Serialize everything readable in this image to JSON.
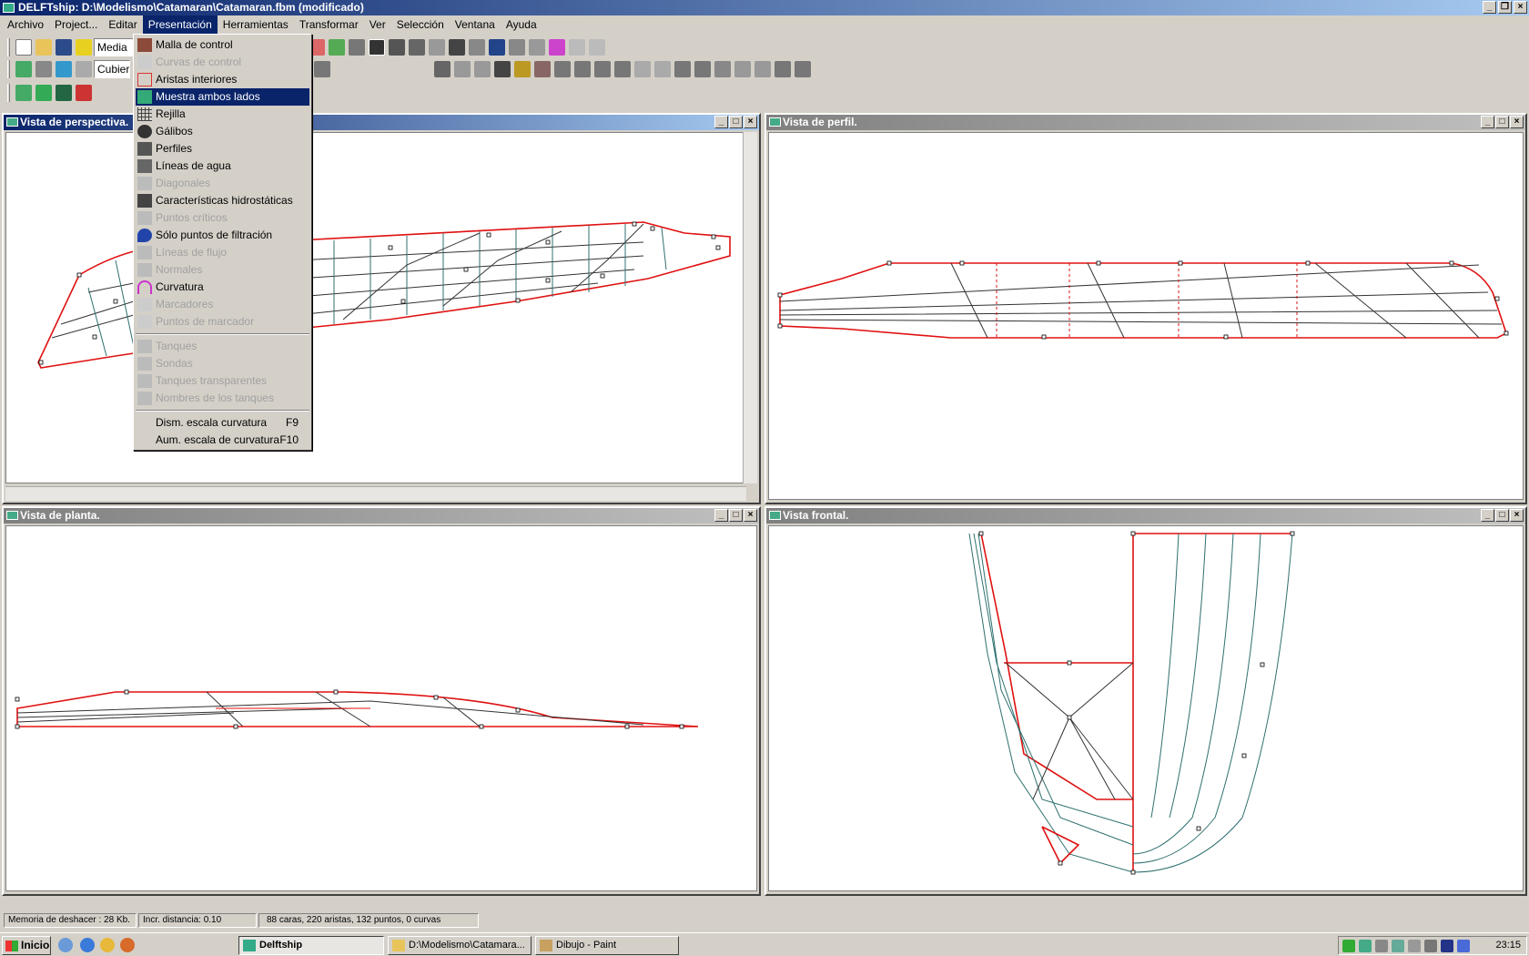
{
  "window": {
    "title": "DELFTship: D:\\Modelismo\\Catamaran\\Catamaran.fbm (modificado)"
  },
  "menubar": [
    "Archivo",
    "Project...",
    "Editar",
    "Presentación",
    "Herramientas",
    "Transformar",
    "Ver",
    "Selección",
    "Ventana",
    "Ayuda"
  ],
  "toolbar": {
    "combo1": "Media",
    "combo2": "Cubierta"
  },
  "dropdown": {
    "items": [
      {
        "label": "Malla de control",
        "enabled": true
      },
      {
        "label": "Curvas de control",
        "enabled": false
      },
      {
        "label": "Aristas interiores",
        "enabled": true
      },
      {
        "label": "Muestra ambos lados",
        "enabled": true,
        "selected": true
      },
      {
        "label": "Rejilla",
        "enabled": true
      },
      {
        "label": "Gálibos",
        "enabled": true
      },
      {
        "label": "Perfiles",
        "enabled": true
      },
      {
        "label": "Líneas de agua",
        "enabled": true
      },
      {
        "label": "Diagonales",
        "enabled": false
      },
      {
        "label": "Características hidrostáticas",
        "enabled": true
      },
      {
        "label": "Puntos críticos",
        "enabled": false
      },
      {
        "label": "Sólo puntos de filtración",
        "enabled": true
      },
      {
        "label": "Líneas de flujo",
        "enabled": false
      },
      {
        "label": "Normales",
        "enabled": false
      },
      {
        "label": "Curvatura",
        "enabled": true
      },
      {
        "label": "Marcadores",
        "enabled": false
      },
      {
        "label": "Puntos de marcador",
        "enabled": false
      }
    ],
    "tank_items": [
      {
        "label": "Tanques",
        "enabled": false
      },
      {
        "label": "Sondas",
        "enabled": false
      },
      {
        "label": "Tanques transparentes",
        "enabled": false
      },
      {
        "label": "Nombres de los tanques",
        "enabled": false
      }
    ],
    "scale_items": [
      {
        "label": "Dism. escala curvatura",
        "shortcut": "F9"
      },
      {
        "label": "Aum. escala de curvatura",
        "shortcut": "F10"
      }
    ]
  },
  "views": {
    "perspective": "Vista de perspectiva.",
    "profile": "Vista de perfil.",
    "plan": "Vista de planta.",
    "front": "Vista frontal."
  },
  "status": {
    "undo": "Memoria de deshacer : 28 Kb.",
    "incr": "Incr. distancia: 0.10",
    "counts": "88 caras, 220 aristas, 132 puntos, 0 curvas"
  },
  "taskbar": {
    "start": "Inicio",
    "tasks": [
      "Delftship",
      "D:\\Modelismo\\Catamara...",
      "Dibujo - Paint"
    ],
    "clock": "23:15"
  },
  "colors": {
    "edge": "#e01010",
    "mesh": "#2f6f6f",
    "title_active": "#0a246a",
    "selection": "#0a246a"
  }
}
